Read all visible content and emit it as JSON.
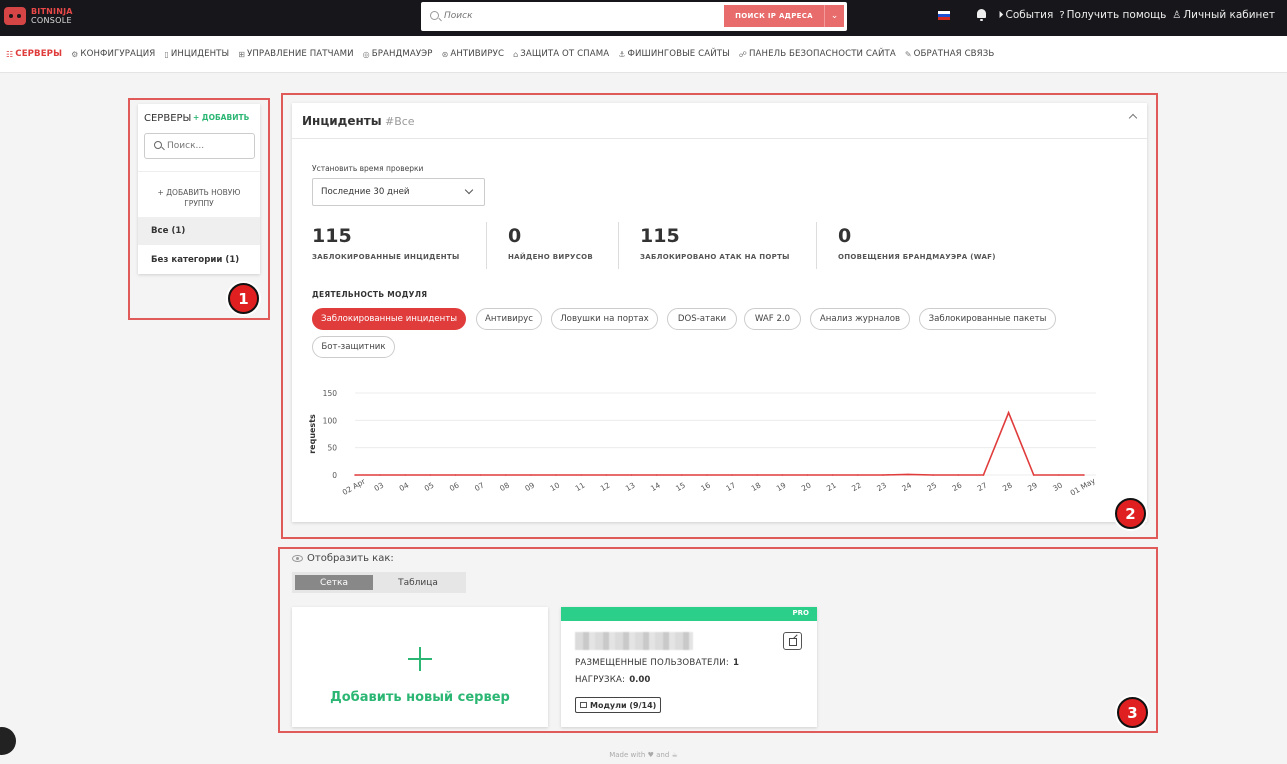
{
  "topbar": {
    "brand": "BITNINJA",
    "brand_sub": "CONSOLE",
    "search_placeholder": "Поиск",
    "search_button": "ПОИСК IP АДРЕСА",
    "events": "События",
    "help": "Получить помощь",
    "account": "Личный кабинет"
  },
  "nav": [
    {
      "label": "СЕРВЕРЫ",
      "glyph": "☷"
    },
    {
      "label": "КОНФИГУРАЦИЯ",
      "glyph": "⚙"
    },
    {
      "label": "ИНЦИДЕНТЫ",
      "glyph": "▯"
    },
    {
      "label": "УПРАВЛЕНИЕ ПАТЧАМИ",
      "glyph": "⊞"
    },
    {
      "label": "БРАНДМАУЭР",
      "glyph": "◎"
    },
    {
      "label": "АНТИВИРУС",
      "glyph": "⊛"
    },
    {
      "label": "ЗАЩИТА ОТ СПАМА",
      "glyph": "⌂"
    },
    {
      "label": "ФИШИНГОВЫЕ САЙТЫ",
      "glyph": "⚓"
    },
    {
      "label": "ПАНЕЛЬ БЕЗОПАСНОСТИ САЙТА",
      "glyph": "☍"
    },
    {
      "label": "ОБРАТНАЯ СВЯЗЬ",
      "glyph": "✎"
    }
  ],
  "servers": {
    "title": "СЕРВЕРЫ",
    "add": "+ ДОБАВИТЬ",
    "search_placeholder": "Поиск...",
    "add_group": "+ ДОБАВИТЬ НОВУЮ ГРУППУ",
    "group_all": "Все (1)",
    "group_none": "Без категории (1)"
  },
  "incidents": {
    "title": "Инциденты",
    "tag": "#Все",
    "period_label": "Установить время проверки",
    "period_value": "Последние 30 дней",
    "stats": [
      {
        "value": "115",
        "label": "ЗАБЛОКИРОВАННЫЕ ИНЦИДЕНТЫ"
      },
      {
        "value": "0",
        "label": "НАЙДЕНО ВИРУСОВ"
      },
      {
        "value": "115",
        "label": "ЗАБЛОКИРОВАНО АТАК НА ПОРТЫ"
      },
      {
        "value": "0",
        "label": "ОПОВЕЩЕНИЯ БРАНДМАУЭРА (WAF)"
      }
    ],
    "module_title": "ДЕЯТЕЛЬНОСТЬ МОДУЛЯ",
    "pills": [
      "Заблокированные инциденты",
      "Антивирус",
      "Ловушки на портах",
      "DOS-атаки",
      "WAF 2.0",
      "Анализ журналов",
      "Заблокированные пакеты",
      "Бот-защитник"
    ]
  },
  "chart_data": {
    "type": "line",
    "ylabel": "requests",
    "ylim": [
      0,
      150
    ],
    "yticks": [
      0,
      50,
      100,
      150
    ],
    "categories": [
      "02 Apr",
      "03",
      "04",
      "05",
      "06",
      "07",
      "08",
      "09",
      "10",
      "11",
      "12",
      "13",
      "14",
      "15",
      "16",
      "17",
      "18",
      "19",
      "20",
      "21",
      "22",
      "23",
      "24",
      "25",
      "26",
      "27",
      "28",
      "29",
      "30",
      "01 May"
    ],
    "series": [
      {
        "values": [
          0,
          0,
          0,
          0,
          0,
          0,
          0,
          0,
          0,
          0,
          0,
          0,
          0,
          0,
          0,
          0,
          0,
          0,
          0,
          0,
          0,
          0,
          1,
          0,
          0,
          0,
          114,
          0,
          0,
          0
        ]
      }
    ],
    "color": "#e03c3c",
    "grid": true
  },
  "display": {
    "label": "Отобразить как:",
    "grid": "Сетка",
    "table": "Таблица",
    "add_server": "Добавить новый сервер",
    "pro": "PRO",
    "users_label": "РАЗМЕЩЕННЫЕ ПОЛЬЗОВАТЕЛИ:",
    "users_value": "1",
    "load_label": "НАГРУЗКА:",
    "load_value": "0.00",
    "modules": "Модули (9/14)"
  },
  "annotations": [
    "1",
    "2",
    "3"
  ],
  "footer": {
    "made": "Made with",
    "and": "and"
  },
  "colors": {
    "accent": "#e03c3c",
    "green": "#2bb673",
    "topbar": "#17171b"
  }
}
